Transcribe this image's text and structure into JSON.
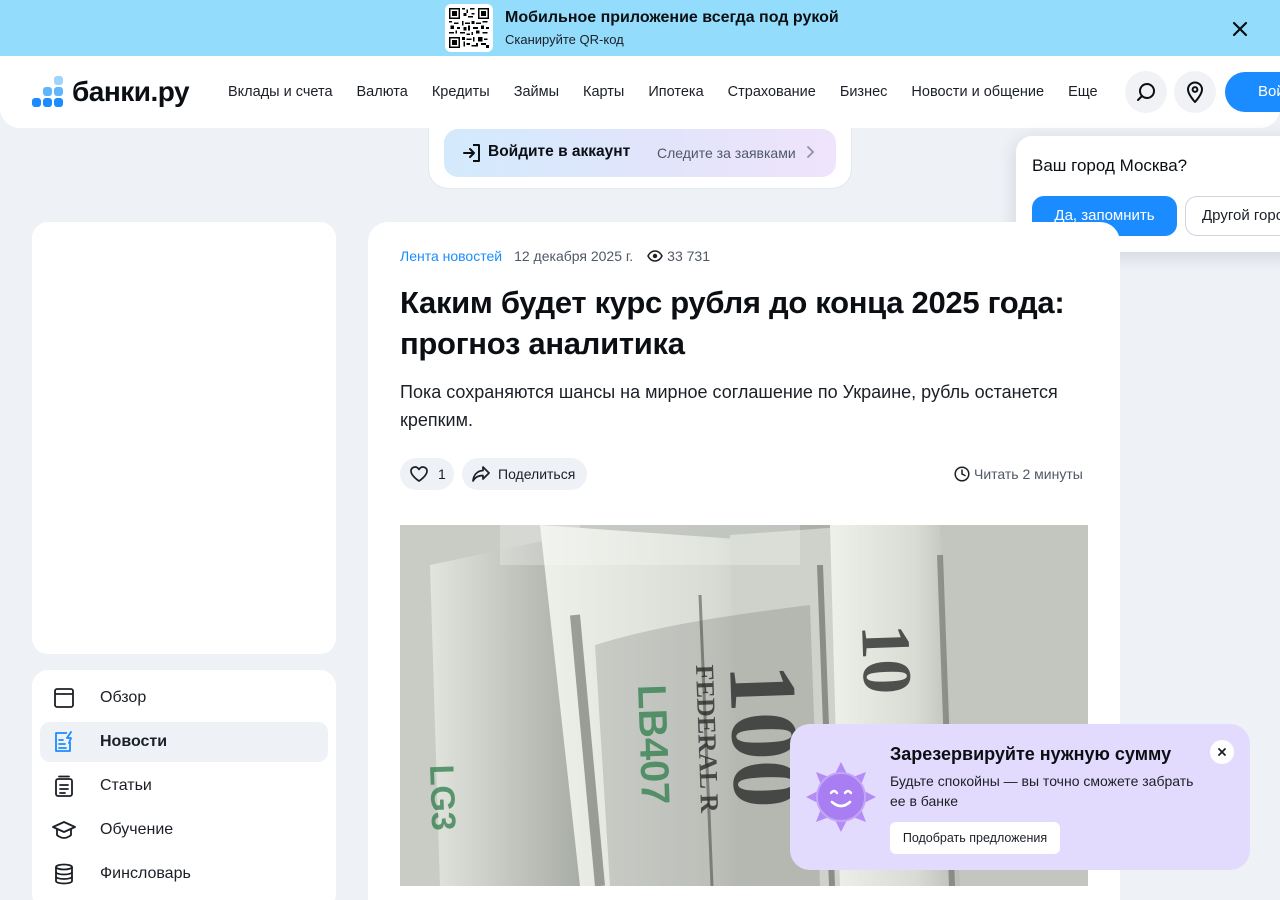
{
  "promo_banner": {
    "title": "Мобильное приложение всегда под рукой",
    "subtitle": "Сканируйте QR-код"
  },
  "header": {
    "logo_text": "банки.ру",
    "nav": [
      "Вклады и счета",
      "Валюта",
      "Кредиты",
      "Займы",
      "Карты",
      "Ипотека",
      "Страхование",
      "Бизнес",
      "Новости и общение",
      "Еще"
    ],
    "login_label": "Войти"
  },
  "login_bar": {
    "label": "Войдите в аккаунт",
    "hint": "Следите за заявками"
  },
  "city_popup": {
    "question": "Ваш город Москва?",
    "confirm": "Да, запомнить",
    "other": "Другой город"
  },
  "sidebar": {
    "items": [
      {
        "label": "Обзор",
        "icon": "overview-icon",
        "active": false
      },
      {
        "label": "Новости",
        "icon": "news-icon",
        "active": true
      },
      {
        "label": "Статьи",
        "icon": "articles-icon",
        "active": false
      },
      {
        "label": "Обучение",
        "icon": "education-icon",
        "active": false
      },
      {
        "label": "Финсловарь",
        "icon": "dictionary-icon",
        "active": false
      }
    ]
  },
  "article": {
    "feed": "Лента новостей",
    "date": "12 декабря 2025 г.",
    "views": "33 731",
    "title": "Каким будет курс рубля до конца 2025 года: прогноз аналитика",
    "lead": "Пока сохраняются шансы на мирное соглашение по Украине, рубль останется крепким.",
    "likes": "1",
    "share": "Поделиться",
    "read_time": "Читать 2 минуты"
  },
  "promo_card": {
    "title": "Зарезервируйте нужную сумму",
    "description": "Будьте спокойны — вы точно сможете забрать ее в банке",
    "button": "Подобрать предложения"
  },
  "colors": {
    "accent": "#1b8cff",
    "banner": "#93dcfc",
    "background": "#eef1f6",
    "promo_card": "#e3dbfd"
  }
}
